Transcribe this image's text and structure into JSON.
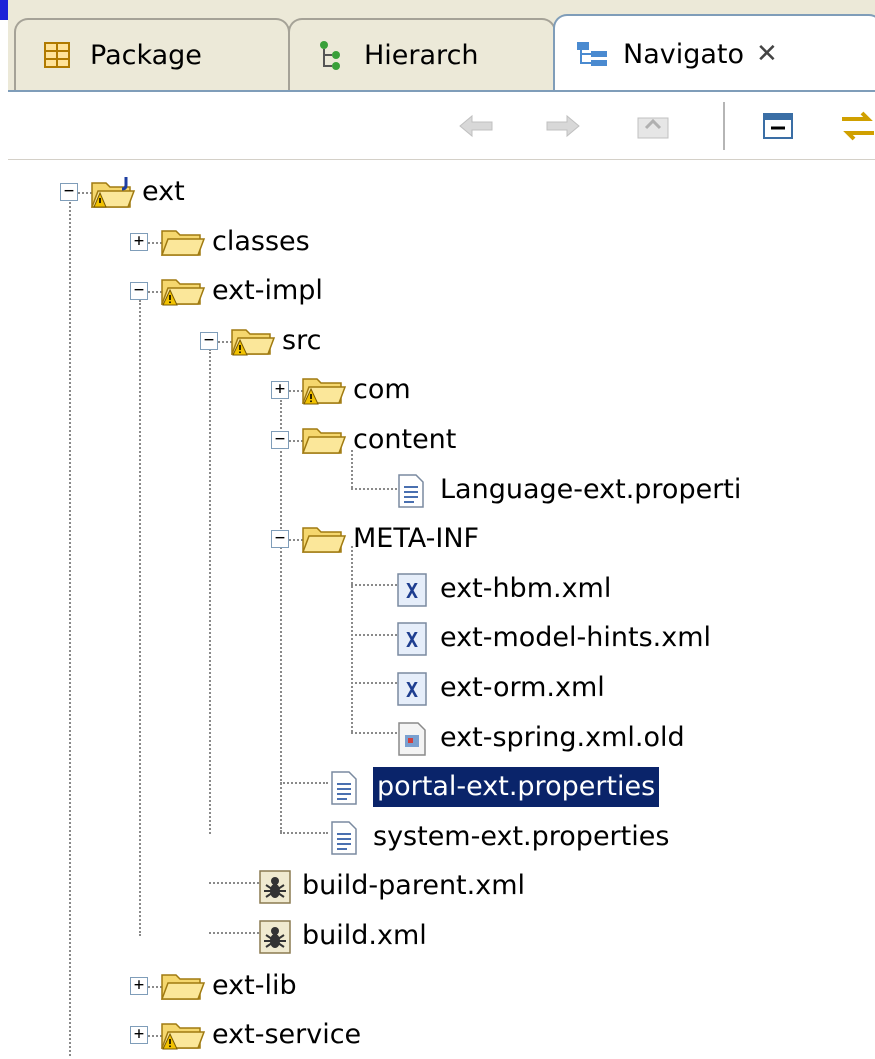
{
  "tabs": [
    {
      "label": "Package",
      "icon": "package-explorer-icon",
      "active": false
    },
    {
      "label": "Hierarch",
      "icon": "hierarchy-icon",
      "active": false
    },
    {
      "label": "Navigato",
      "icon": "navigator-icon",
      "active": true
    }
  ],
  "close_glyph": "✕",
  "toolbar": {
    "buttons": [
      "back-arrow-icon",
      "forward-arrow-icon",
      "go-up-icon",
      "collapse-all-icon",
      "link-with-editor-icon"
    ]
  },
  "tree": [
    {
      "label": "ext",
      "depth": 0,
      "expander": "minus",
      "icon": "project-folder-icon"
    },
    {
      "label": "classes",
      "depth": 1,
      "expander": "plus",
      "icon": "folder-icon"
    },
    {
      "label": "ext-impl",
      "depth": 1,
      "expander": "minus",
      "icon": "folder-warning-icon"
    },
    {
      "label": "src",
      "depth": 2,
      "expander": "minus",
      "icon": "folder-warning-icon"
    },
    {
      "label": "com",
      "depth": 3,
      "expander": "plus",
      "icon": "folder-warning-icon"
    },
    {
      "label": "content",
      "depth": 3,
      "expander": "minus",
      "icon": "folder-icon"
    },
    {
      "label": "Language-ext.properti",
      "depth": 4,
      "expander": "",
      "icon": "text-file-icon"
    },
    {
      "label": "META-INF",
      "depth": 3,
      "expander": "minus",
      "icon": "folder-icon"
    },
    {
      "label": "ext-hbm.xml",
      "depth": 4,
      "expander": "",
      "icon": "xml-file-icon"
    },
    {
      "label": "ext-model-hints.xml",
      "depth": 4,
      "expander": "",
      "icon": "xml-file-icon"
    },
    {
      "label": "ext-orm.xml",
      "depth": 4,
      "expander": "",
      "icon": "xml-file-icon"
    },
    {
      "label": "ext-spring.xml.old",
      "depth": 4,
      "expander": "",
      "icon": "generic-file-icon"
    },
    {
      "label": "portal-ext.properties",
      "depth": 3,
      "expander": "",
      "icon": "text-file-icon",
      "selected": true
    },
    {
      "label": "system-ext.properties",
      "depth": 3,
      "expander": "",
      "icon": "text-file-icon"
    },
    {
      "label": "build-parent.xml",
      "depth": 2,
      "expander": "",
      "icon": "ant-file-icon"
    },
    {
      "label": "build.xml",
      "depth": 2,
      "expander": "",
      "icon": "ant-file-icon"
    },
    {
      "label": "ext-lib",
      "depth": 1,
      "expander": "plus",
      "icon": "folder-icon"
    },
    {
      "label": "ext-service",
      "depth": 1,
      "expander": "plus",
      "icon": "folder-warning-icon"
    }
  ],
  "colors": {
    "selection": "#0a246a",
    "warning": "#f2c200",
    "folder": "#f5d76e",
    "tab_border_active": "#7f9db9"
  }
}
